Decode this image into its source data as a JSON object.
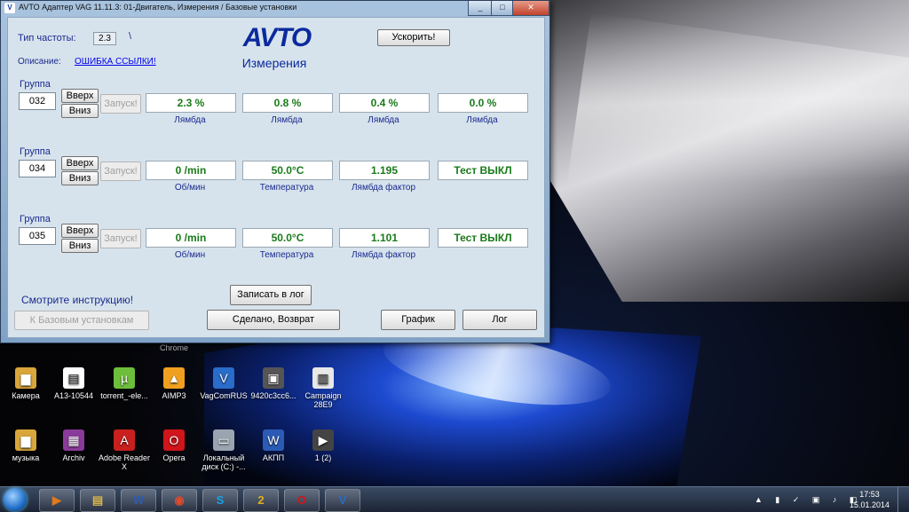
{
  "window": {
    "title": "AVTO Адаптер VAG 11.11.3: 01-Двигатель,  Измерения / Базовые установки",
    "logo": "AVTO",
    "subtitle": "Измерения"
  },
  "header": {
    "freq_label": "Тип частоты:",
    "freq_value": "2.3",
    "freq_mark": "\\",
    "desc_label": "Описание:",
    "desc_link": "ОШИБКА ССЫЛКИ!",
    "speedup_button": "Ускорить!"
  },
  "groups": [
    {
      "label": "Группа",
      "number": "032",
      "up": "Вверх",
      "down": "Вниз",
      "start": "Запуск!",
      "cells": [
        {
          "value": "2.3 %",
          "unit": "Лямбда"
        },
        {
          "value": "0.8 %",
          "unit": "Лямбда"
        },
        {
          "value": "0.4 %",
          "unit": "Лямбда"
        },
        {
          "value": "0.0 %",
          "unit": "Лямбда"
        }
      ]
    },
    {
      "label": "Группа",
      "number": "034",
      "up": "Вверх",
      "down": "Вниз",
      "start": "Запуск!",
      "cells": [
        {
          "value": "0 /min",
          "unit": "Об/мин"
        },
        {
          "value": "50.0°C",
          "unit": "Температура"
        },
        {
          "value": "1.195",
          "unit": "Лямбда фактор"
        },
        {
          "value": "Тест ВЫКЛ",
          "unit": ""
        }
      ]
    },
    {
      "label": "Группа",
      "number": "035",
      "up": "Вверх",
      "down": "Вниз",
      "start": "Запуск!",
      "cells": [
        {
          "value": "0 /min",
          "unit": "Об/мин"
        },
        {
          "value": "50.0°C",
          "unit": "Температура"
        },
        {
          "value": "1.101",
          "unit": "Лямбда фактор"
        },
        {
          "value": "Тест ВЫКЛ",
          "unit": ""
        }
      ]
    }
  ],
  "footer": {
    "instructions_link": "Смотрите инструкцию!",
    "log_write_button": "Записать в лог",
    "basic_settings_button": "К Базовым установкам",
    "done_button": "Сделано, Возврат",
    "graph_button": "График",
    "log_button": "Лог"
  },
  "desktop": {
    "chrome_label": "Chrome",
    "icons": [
      {
        "label": "Камера",
        "icon": "folder-icon",
        "color": "#d9a63b"
      },
      {
        "label": "A13-10544",
        "icon": "document-icon",
        "color": "#ffffff"
      },
      {
        "label": "torrent_-ele...",
        "icon": "utorrent-icon",
        "color": "#6dbf3b"
      },
      {
        "label": "AIMP3",
        "icon": "aimp-icon",
        "color": "#f0a020"
      },
      {
        "label": "VagComRUS",
        "icon": "vag-icon",
        "color": "#2a6cc9"
      },
      {
        "label": "9420c3cc6...",
        "icon": "image-icon",
        "color": "#555555"
      },
      {
        "label": "Campaign 28E9",
        "icon": "notes-icon",
        "color": "#e8e8e8"
      },
      {
        "label": "музыка",
        "icon": "folder-icon",
        "color": "#d9a63b"
      },
      {
        "label": "Archiv",
        "icon": "winrar-icon",
        "color": "#8a3a9a"
      },
      {
        "label": "Adobe Reader X",
        "icon": "pdf-icon",
        "color": "#c8201e"
      },
      {
        "label": "Opera",
        "icon": "opera-icon",
        "color": "#d0151b"
      },
      {
        "label": "Локальный диск (С:) -...",
        "icon": "drive-icon",
        "color": "#9aa4b0"
      },
      {
        "label": "АКПП",
        "icon": "word-doc-icon",
        "color": "#2b5bb5"
      },
      {
        "label": "1 (2)",
        "icon": "media-file-icon",
        "color": "#444444"
      }
    ]
  },
  "taskbar": {
    "items": [
      {
        "icon": "media-player-icon",
        "glyph": "▶",
        "color": "#e07a1a"
      },
      {
        "icon": "explorer-icon",
        "glyph": "▤",
        "color": "#d9b44a"
      },
      {
        "icon": "word-icon",
        "glyph": "W",
        "color": "#2b5bb5"
      },
      {
        "icon": "chrome-icon",
        "glyph": "◉",
        "color": "#e04a2a"
      },
      {
        "icon": "skype-icon",
        "glyph": "S",
        "color": "#1aa0e0"
      },
      {
        "icon": "kaspersky-icon",
        "glyph": "2",
        "color": "#e0b01a"
      },
      {
        "icon": "opera-icon",
        "glyph": "O",
        "color": "#d0151b"
      },
      {
        "icon": "vag-icon",
        "glyph": "V",
        "color": "#2a6cc9"
      }
    ],
    "time": "17:53",
    "date": "15.01.2014"
  }
}
